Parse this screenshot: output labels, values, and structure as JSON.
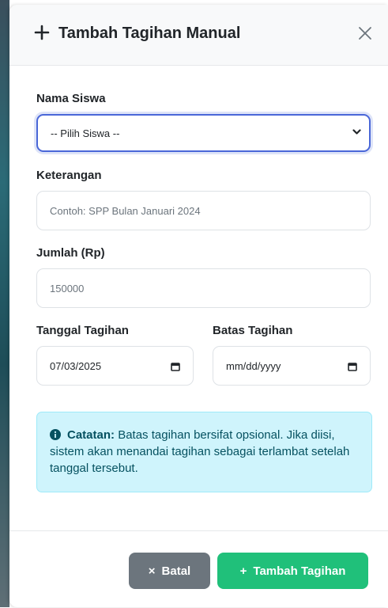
{
  "modal": {
    "title": "Tambah Tagihan Manual",
    "icons": {
      "title": "plus-icon",
      "close": "close-icon"
    }
  },
  "form": {
    "student": {
      "label": "Nama Siswa",
      "value": "-- Pilih Siswa --"
    },
    "description": {
      "label": "Keterangan",
      "placeholder": "Contoh: SPP Bulan Januari 2024"
    },
    "amount": {
      "label": "Jumlah (Rp)",
      "placeholder": "150000"
    },
    "bill_date": {
      "label": "Tanggal Tagihan",
      "value": "07/03/2025"
    },
    "due_date": {
      "label": "Batas Tagihan",
      "placeholder": "mm/dd/yyyy"
    }
  },
  "note": {
    "bold": "Catatan:",
    "text": "Batas tagihan bersifat opsional. Jika diisi, sistem akan menandai tagihan sebagai terlambat setelah tanggal tersebut."
  },
  "footer": {
    "cancel_label": "Batal",
    "add_label": "Tambah Tagihan",
    "cancel_icon": "×",
    "add_icon": "+"
  },
  "colors": {
    "primary_focus": "#4a67d8",
    "success": "#20c07a",
    "secondary": "#6c757d",
    "info_bg": "#cff4fc",
    "info_text": "#055160"
  }
}
